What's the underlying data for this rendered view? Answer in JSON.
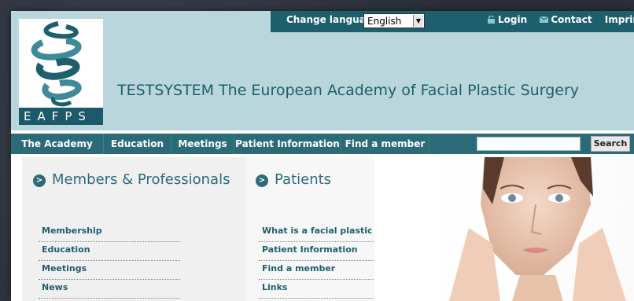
{
  "header": {
    "change_language_label": "Change language",
    "language_selected": "English",
    "login_label": "Login",
    "contact_label": "Contact",
    "imprint_label": "Imprint",
    "site_title": "TESTSYSTEM The European Academy of Facial Plastic Surgery",
    "logo_text": "EAFPS"
  },
  "nav": {
    "items": [
      "The Academy",
      "Education",
      "Meetings",
      "Patient Information",
      "Find a member"
    ],
    "search_placeholder": "",
    "search_button": "Search"
  },
  "members": {
    "title": "Members & Professionals",
    "links": [
      "Membership",
      "Education",
      "Meetings",
      "News"
    ]
  },
  "patients": {
    "title": "Patients",
    "links": [
      "What is a facial plastic surgeon?",
      "Patient Information",
      "Find a member",
      "Links"
    ]
  },
  "colors": {
    "header_bg": "#b9d6dc",
    "nav_bg": "#2b6b78",
    "accent": "#1d5f6d"
  }
}
